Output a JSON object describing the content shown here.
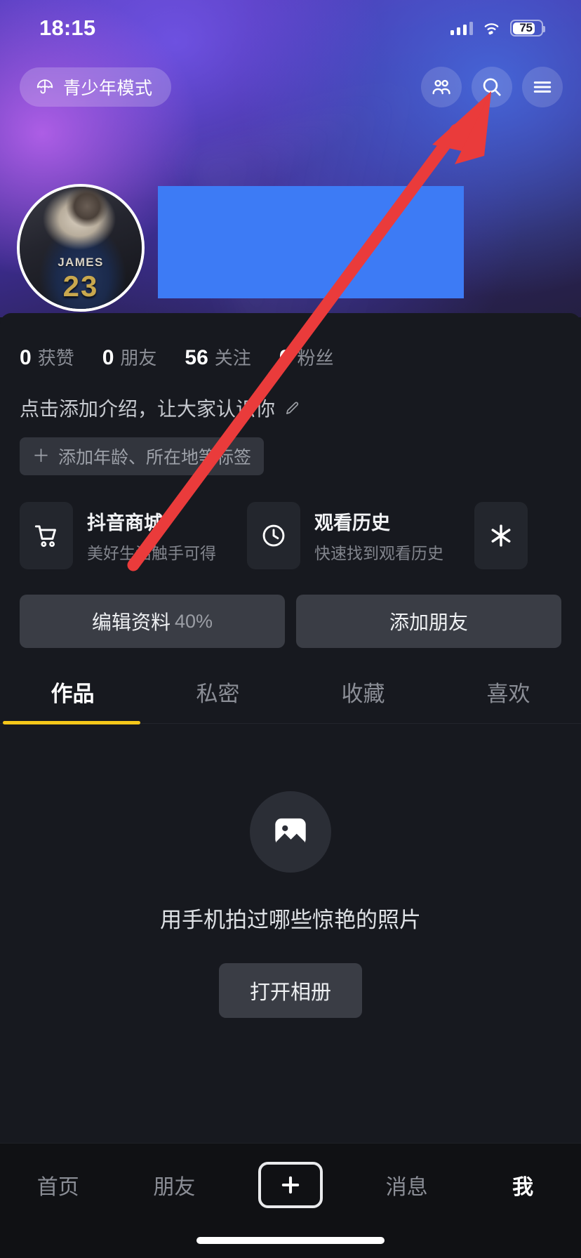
{
  "status_bar": {
    "time": "18:15",
    "battery_level": "75",
    "signal_icon": "cellular-bars-icon",
    "wifi_icon": "wifi-icon",
    "battery_icon": "battery-icon"
  },
  "top_nav": {
    "teen_mode": {
      "label": "青少年模式",
      "icon": "umbrella-icon"
    },
    "icons": [
      {
        "name": "friends-icon",
        "label": "朋友"
      },
      {
        "name": "search-icon",
        "label": "搜索"
      },
      {
        "name": "hamburger-menu-icon",
        "label": "菜单"
      }
    ]
  },
  "profile": {
    "avatar": {
      "icon": "avatar-photo",
      "jersey_name": "JAMES",
      "jersey_number": "23"
    },
    "redacted_name_block": "",
    "stats": [
      {
        "value": "0",
        "label": "获赞"
      },
      {
        "value": "0",
        "label": "朋友"
      },
      {
        "value": "56",
        "label": "关注"
      },
      {
        "value": "0",
        "label": "粉丝"
      }
    ],
    "bio_placeholder": "点击添加介绍，让大家认识你",
    "bio_edit_icon": "pencil-icon",
    "tag_plus": "＋",
    "tag_label": "添加年龄、所在地等标签"
  },
  "shortcut_cards": [
    {
      "title": "抖音商城",
      "subtitle": "美好生活触手可得",
      "icon": "shopping-cart-icon"
    },
    {
      "title": "观看历史",
      "subtitle": "快速找到观看历史",
      "icon": "clock-icon"
    }
  ],
  "shortcut_card_partial": {
    "icon": "asterisk-icon"
  },
  "actions": {
    "edit_profile_label": "编辑资料",
    "edit_profile_percent": "40%",
    "add_friend_label": "添加朋友"
  },
  "content_tabs": [
    {
      "label": "作品",
      "active": true
    },
    {
      "label": "私密",
      "active": false
    },
    {
      "label": "收藏",
      "active": false
    },
    {
      "label": "喜欢",
      "active": false
    }
  ],
  "empty_state": {
    "icon": "photo-image-icon",
    "text": "用手机拍过哪些惊艳的照片",
    "button_label": "打开相册"
  },
  "bottom_nav": [
    {
      "label": "首页",
      "active": false
    },
    {
      "label": "朋友",
      "active": false
    },
    {
      "label": "＋",
      "active": false,
      "icon": "plus-icon"
    },
    {
      "label": "消息",
      "active": false
    },
    {
      "label": "我",
      "active": true
    }
  ],
  "annotation": {
    "arrow_color": "#ea3b3b",
    "icon": "pointer-arrow"
  },
  "colors": {
    "accent_yellow": "#f5c71a",
    "redaction_blue": "#3d7bf5",
    "sheet_bg": "#17191f",
    "card_bg": "#23262d",
    "button_bg": "#3a3d45"
  }
}
